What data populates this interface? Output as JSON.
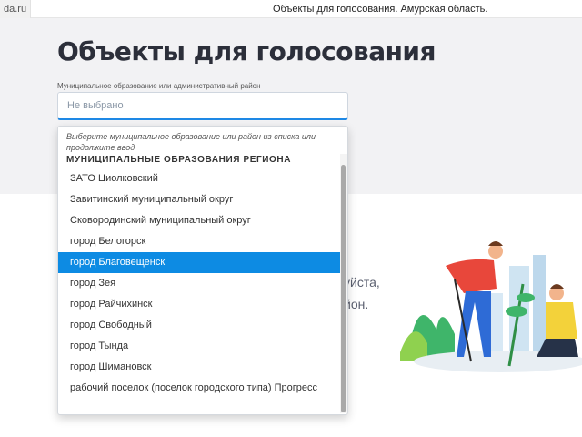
{
  "browser": {
    "url_fragment": "da.ru",
    "window_title": "Объекты для голосования. Амурская область."
  },
  "page": {
    "title": "Объекты для голосования",
    "field_label": "Муниципальное образование или административный район",
    "select_value": "Не выбрано"
  },
  "background_text": {
    "line1": "уйста,",
    "line2": "йон."
  },
  "dropdown": {
    "hint": "Выберите муниципальное образование или район из списка или продолжите ввод",
    "group_header": "МУНИЦИПАЛЬНЫЕ ОБРАЗОВАНИЯ РЕГИОНА",
    "options": [
      "ЗАТО Циолковский",
      "Завитинский муниципальный округ",
      "Сковородинский муниципальный округ",
      "город Белогорск",
      "город Благовещенск",
      "город Зея",
      "город Райчихинск",
      "город Свободный",
      "город Тында",
      "город Шимановск",
      "рабочий поселок (поселок городского типа) Прогресс"
    ],
    "selected_option": "город Благовещенск"
  },
  "colors": {
    "accent": "#0d8be3",
    "hero_bg": "#f2f2f4",
    "title": "#2c2f3a"
  }
}
